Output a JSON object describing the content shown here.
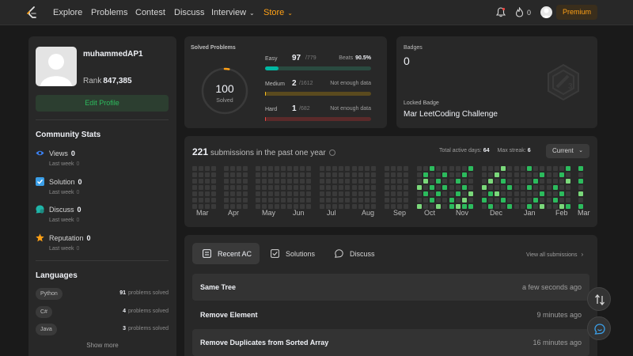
{
  "nav": {
    "links": [
      "Explore",
      "Problems",
      "Contest",
      "Discuss",
      "Interview",
      "Store"
    ],
    "streak_count": "0",
    "premium_label": "Premium"
  },
  "profile": {
    "username": "muhammedAP1",
    "rank_label": "Rank",
    "rank_value": "847,385",
    "edit_label": "Edit Profile",
    "community_title": "Community Stats",
    "stats": [
      {
        "label": "Views",
        "value": "0",
        "sub_label": "Last week",
        "sub_value": "0",
        "icon": "eye-icon"
      },
      {
        "label": "Solution",
        "value": "0",
        "sub_label": "Last week",
        "sub_value": "0",
        "icon": "solution-icon"
      },
      {
        "label": "Discuss",
        "value": "0",
        "sub_label": "Last week",
        "sub_value": "0",
        "icon": "discuss-icon"
      },
      {
        "label": "Reputation",
        "value": "0",
        "sub_label": "Last week",
        "sub_value": "0",
        "icon": "star-icon"
      }
    ],
    "languages_title": "Languages",
    "languages": [
      {
        "name": "Python",
        "count": "91",
        "suffix": "problems solved"
      },
      {
        "name": "C#",
        "count": "4",
        "suffix": "problems solved"
      },
      {
        "name": "Java",
        "count": "3",
        "suffix": "problems solved"
      }
    ],
    "show_more": "Show more"
  },
  "solved": {
    "title": "Solved Problems",
    "total": "100",
    "total_label": "Solved",
    "ring_fraction": 0.03,
    "levels": [
      {
        "name": "Easy",
        "count": "97",
        "total": "/779",
        "beats_label": "Beats",
        "beats_value": "90.5%",
        "note": "",
        "fraction": 0.125,
        "color": "#00b8a3",
        "track": "#2a4a40"
      },
      {
        "name": "Medium",
        "count": "2",
        "total": "/1612",
        "beats_label": "",
        "beats_value": "",
        "note": "Not enough data",
        "fraction": 0.0012,
        "color": "#ffc01e",
        "track": "#5a4a1e"
      },
      {
        "name": "Hard",
        "count": "1",
        "total": "/682",
        "beats_label": "",
        "beats_value": "",
        "note": "Not enough data",
        "fraction": 0.0015,
        "color": "#ef4743",
        "track": "#5a2a2a"
      }
    ]
  },
  "badges": {
    "title": "Badges",
    "count": "0",
    "locked_title": "Locked Badge",
    "locked_name": "Mar LeetCoding Challenge",
    "badge_icon": "locked-badge-icon"
  },
  "calendar": {
    "count": "221",
    "head_text": "submissions in the past one year",
    "active_days_label": "Total active days:",
    "active_days": "64",
    "max_streak_label": "Max streak:",
    "max_streak": "6",
    "current_label": "Current",
    "months": [
      "Mar",
      "Apr",
      "May",
      "Jun",
      "Jul",
      "Aug",
      "Sep",
      "Oct",
      "Nov",
      "Dec",
      "Jan",
      "Feb",
      "Mar"
    ]
  },
  "activity": {
    "tabs": [
      {
        "label": "Recent AC",
        "icon": "recent-ac-icon"
      },
      {
        "label": "Solutions",
        "icon": "solutions-icon"
      },
      {
        "label": "Discuss",
        "icon": "discuss-icon"
      }
    ],
    "view_all": "View all submissions",
    "submissions": [
      {
        "name": "Same Tree",
        "time": "a few seconds ago"
      },
      {
        "name": "Remove Element",
        "time": "9 minutes ago"
      },
      {
        "name": "Remove Duplicates from Sorted Array",
        "time": "16 minutes ago"
      }
    ]
  }
}
